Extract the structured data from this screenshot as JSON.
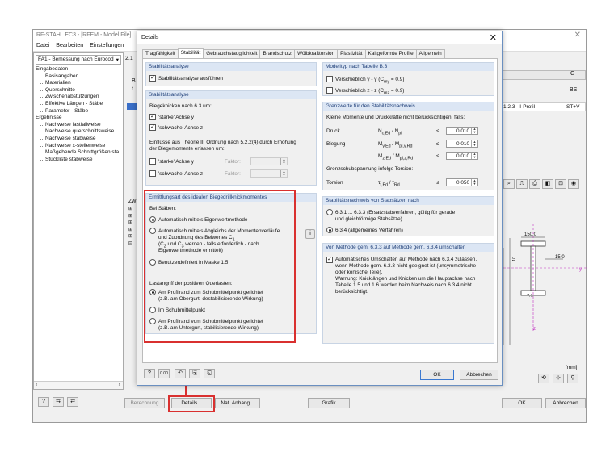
{
  "main_window": {
    "title": "RF-STAHL EC3 - [RFEM - Model File]",
    "menu": [
      "Datei",
      "Bearbeiten",
      "Einstellungen"
    ],
    "case_combo": "FA1 - Bemessung nach Eurocod",
    "case_num": "2.1",
    "tree": {
      "group_input": "Eingabedaten",
      "input_items": [
        "Basisangaben",
        "Materialien",
        "Querschnitte",
        "Zwischenabstützungen",
        "Effektive Längen - Stäbe",
        "Parameter - Stäbe"
      ],
      "group_results": "Ergebnisse",
      "result_items": [
        "Nachweise lastfallweise",
        "Nachweise querschnittsweise",
        "Nachweise stabweise",
        "Nachweise x-stellenweise",
        "Maßgebende Schnittgrößen sta",
        "Stückliste stabweise"
      ]
    },
    "right_headers": {
      "col_g": "G",
      "bs": "BS",
      "profile": "1.2.3 - I-Profil",
      "stv": "ST+V"
    },
    "section_dims": {
      "top": "150.0",
      "right": "15.0",
      "web": "10",
      "flange": "7.1",
      "unit": "[mm]"
    },
    "left_bits": {
      "b": "B",
      "t": "t",
      "zw": "Zw"
    },
    "bottom_buttons": {
      "berechnung": "Berechnung",
      "details": "Details...",
      "nat_anhang": "Nat. Anhang...",
      "grafik": "Grafik",
      "ok": "OK",
      "abbrechen": "Abbrechen"
    }
  },
  "dialog": {
    "title": "Details",
    "tabs": [
      "Tragfähigkeit",
      "Stabilität",
      "Gebrauchstauglichkeit",
      "Brandschutz",
      "Wölbkrafttorsion",
      "Plastizität",
      "Kaltgeformte Profile",
      "Allgemein"
    ],
    "active_tab": "Stabilität",
    "stab1": {
      "header": "Stabilitätsanalyse",
      "option": "Stabilitätsanalyse ausführen"
    },
    "stab2": {
      "header": "Stabilitätsanalyse",
      "biegeknicken": "Biegeknicken nach 6.3 um:",
      "strong": "'starke' Achse y",
      "weak": "'schwache' Achse z",
      "einfluss": "Einflüsse aus Theorie II. Ordnung nach 5.2.2(4) durch Erhöhung der Biegemomente erfassen um:",
      "einfluss1": "Einflüsse aus Theorie II. Ordnung nach 5.2.2(4) durch Erhöhung",
      "einfluss2": "der Biegemomente erfassen um:",
      "strong2": "'starke' Achse y",
      "weak2": "'schwache' Achse z",
      "faktor": "Faktor:"
    },
    "ermittlung": {
      "header": "Ermittlungsart des idealen Biegedrillknickmomentes",
      "bei_staeben": "Bei Stäben:",
      "opt1": "Automatisch mittels Eigenwertmethode",
      "opt2_l1": "Automatisch mittels Abgleichs der Momentenverläufe",
      "opt2_l2": "und Zuordnung des Beiwertes C",
      "opt2_l3": "(C",
      "opt2_l3b": "2",
      "opt2_l3c": " und C",
      "opt2_l3d": "3",
      "opt2_l3e": " werden - falls erforderlich - nach",
      "opt2_l4": "Eigenwertmethode ermittelt)",
      "sub1": "1",
      "opt3": "Benutzerdefiniert in Maske 1.5",
      "last": "Lastangriff der positiven Querlasten:",
      "q1_l1": "Am Profilrand zum Schubmittelpunkt gerichtet",
      "q1_l2": "(z.B. am Obergurt, destabilisierende Wirkung)",
      "q2": "Im Schubmittelpunkt",
      "q3_l1": "Am Profilrand vom Schubmittelpunkt gerichtet",
      "q3_l2": "(z.B. am Untergurt, stabilisierende Wirkung)"
    },
    "modelltyp": {
      "header": "Modelltyp nach Tabelle B.3",
      "opt1": "Verschieblich y - y (C",
      "opt1b": "my",
      "opt1c": " = 0.9)",
      "opt2": "Verschieblich z - z (C",
      "opt2b": "mz",
      "opt2c": " = 0.9)"
    },
    "grenz": {
      "header": "Grenzwerte für den Stabilitätsnachweis",
      "intro": "Kleine Momente und Druckkräfte nicht berücksichtigen, falls:",
      "rows": [
        {
          "name": "Druck",
          "ratio": "N",
          "sub": "c,Ed",
          "rest": " / N",
          "sub2": "pl",
          "value": "0.010"
        },
        {
          "name": "Biegung",
          "ratio": "M",
          "sub": "y,Ed",
          "rest": " / M",
          "sub2": "pl,y,Rd",
          "value": "0.010"
        },
        {
          "name": "",
          "ratio": "M",
          "sub": "z,Ed",
          "rest": " / M",
          "sub2": "pl,z,Rd",
          "value": "0.010"
        }
      ],
      "le": "≤",
      "schub": "Grenzschubspannung infolge Torsion:",
      "torsion": "Torsion",
      "tau": "τ",
      "tausub": "t,Ed",
      "taurest": " / τ",
      "tausub2": "Rd",
      "torsion_value": "0.050"
    },
    "satz": {
      "header": "Stabilitätsnachweis von Stabsätzen nach",
      "opt1_l1": "6.3.1 ... 6.3.3  (Ersatzstabverfahren, gültig für gerade",
      "opt1_l2": "und gleichförmige Stabsätze)",
      "opt2": "6.3.4 (allgemeines Verfahren)"
    },
    "methode": {
      "header": "Von Methode gem. 6.3.3 auf Methode gem. 6.3.4 umschalten",
      "l1": "Automatisches Umschalten auf Methode nach 6.3.4 zulassen,",
      "l2": "wenn Methode gem. 6.3.3 nicht geeignet ist (unsymmetrische",
      "l3": "oder konische Teile).",
      "l4": "Warnung: Knicklängen und Knicken um die Hauptachse nach",
      "l5": "Tabelle 1.5 und 1.6 werden beim Nachweis nach 6.3.4 nicht",
      "l6": "berücksichtigt."
    },
    "ok": "OK",
    "abbrechen": "Abbrechen"
  },
  "colors": {
    "accent": "#1f3f78",
    "section_header": "#dce6f4",
    "highlight": "#d9302f"
  }
}
